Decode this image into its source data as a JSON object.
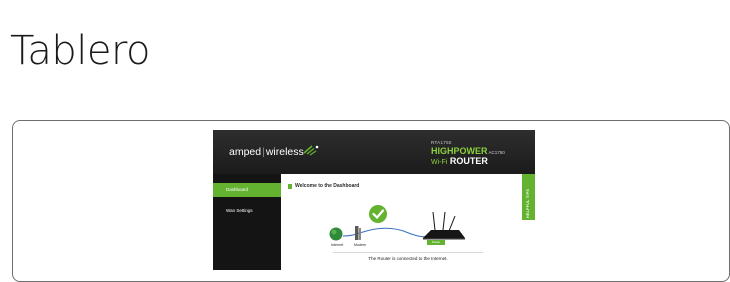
{
  "page": {
    "title": "Tablero"
  },
  "router_ui": {
    "brand": {
      "name_left": "amped",
      "separator": "|",
      "name_right": "wireless"
    },
    "model": {
      "name": "RTA1750",
      "line1": "HIGHPOWER",
      "line1_suffix": "AC1750",
      "line2_prefix": "Wi-Fi",
      "line2": "ROUTER"
    },
    "nav": [
      {
        "label": "Dashboard",
        "active": true
      },
      {
        "label": "Wan Settings",
        "active": false
      }
    ],
    "welcome_title": "Welcome to the Dashboard",
    "diagram": {
      "labels": {
        "internet": "Internet",
        "modem": "Modem",
        "router": "Router"
      }
    },
    "status_text": "The Router is connected to the Internet.",
    "helpful_tips": "HELPFUL TIPS",
    "colors": {
      "accent": "#63b230",
      "header_bg": "#1f1f1f",
      "sidebar_bg": "#141414"
    }
  }
}
